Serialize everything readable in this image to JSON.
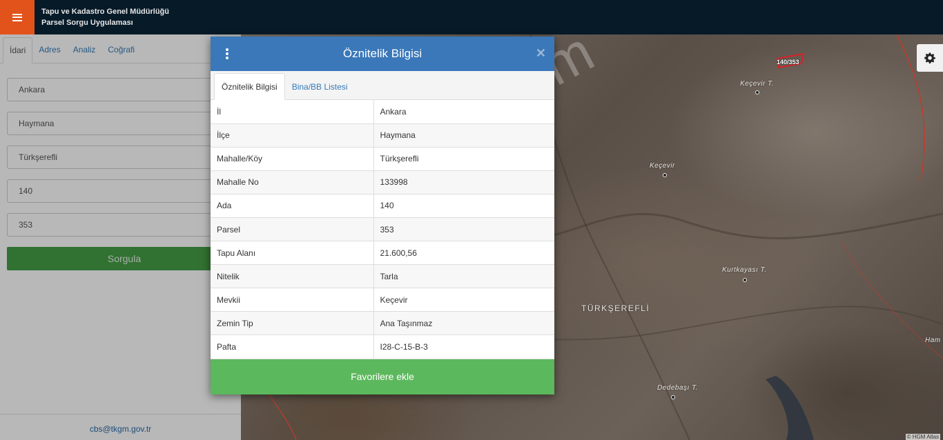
{
  "header": {
    "org_name": "Tapu ve Kadastro Genel Müdürlüğü",
    "app_name": "Parsel Sorgu Uygulaması",
    "menu_icon": "hamburger-icon"
  },
  "sidebar": {
    "tabs": [
      {
        "label": "İdari",
        "active": true
      },
      {
        "label": "Adres",
        "active": false
      },
      {
        "label": "Analiz",
        "active": false
      },
      {
        "label": "Coğrafi",
        "active": false
      }
    ],
    "fields": [
      "Ankara",
      "Haymana",
      "Türkşerefli",
      "140",
      "353"
    ],
    "query_button": "Sorgula",
    "footer_email": "cbs@tkgm.gov.tr"
  },
  "map": {
    "parcel_label": "140/353",
    "places": [
      "Keçevir T.",
      "Keçevir",
      "Kurtkayası T.",
      "TÜRKŞEREFLİ",
      "Dedebaşı T.",
      "Ham"
    ],
    "attribution": "© HGM Atlas",
    "watermark": "emlakjet.com",
    "settings_icon": "gear-icon"
  },
  "modal": {
    "title": "Öznitelik Bilgisi",
    "tabs": [
      {
        "label": "Öznitelik Bilgisi",
        "active": true
      },
      {
        "label": "Bina/BB Listesi",
        "active": false
      }
    ],
    "rows": [
      {
        "key": "İl",
        "value": "Ankara"
      },
      {
        "key": "İlçe",
        "value": "Haymana"
      },
      {
        "key": "Mahalle/Köy",
        "value": "Türkşerefli"
      },
      {
        "key": "Mahalle No",
        "value": "133998"
      },
      {
        "key": "Ada",
        "value": "140"
      },
      {
        "key": "Parsel",
        "value": "353"
      },
      {
        "key": "Tapu Alanı",
        "value": "21.600,56"
      },
      {
        "key": "Nitelik",
        "value": "Tarla"
      },
      {
        "key": "Mevkii",
        "value": "Keçevir"
      },
      {
        "key": "Zemin Tip",
        "value": "Ana Taşınmaz"
      },
      {
        "key": "Pafta",
        "value": "I28-C-15-B-3"
      }
    ],
    "favorite_button": "Favorilere ekle",
    "colors": {
      "header": "#3a78b9",
      "favorite": "#5cb85c",
      "query": "#449d44",
      "menu": "#e2531b"
    }
  }
}
